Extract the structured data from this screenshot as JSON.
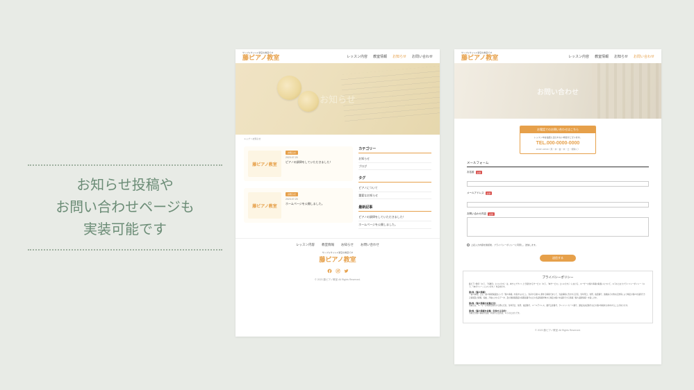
{
  "promo": {
    "line1": "お知らせ投稿や",
    "line2": "お問い合わせページも",
    "line3": "実装可能です"
  },
  "site": {
    "tagline": "サンプルサイト2 架空の教室です",
    "logo": "藤ピアノ教室",
    "nav": {
      "lesson": "レッスン内容",
      "classroom": "教室情報",
      "news": "お知らせ",
      "contact": "お問い合わせ"
    }
  },
  "news_page": {
    "hero_title": "お知らせ",
    "breadcrumb": "トップ > お知らせ",
    "posts": [
      {
        "thumb_text": "藤ピアノ教室",
        "category": "お知らせ",
        "date": "2023.07.25",
        "title": "ピアノの調律をしていただきました！"
      },
      {
        "thumb_text": "藤ピアノ教室",
        "category": "お知らせ",
        "date": "2023.07.25",
        "title": "ホームページを公開しました。"
      }
    ],
    "sidebar": {
      "category_title": "カテゴリー",
      "categories": [
        "お知らせ",
        "ブログ"
      ],
      "tag_title": "タグ",
      "tags": [
        "ピアノについて",
        "重要なお知らせ"
      ],
      "recent_title": "最新記事",
      "recent": [
        "ピアノの調律をしていただきました！",
        "ホームページを公開しました。"
      ]
    }
  },
  "contact_page": {
    "hero_title": "お問い合わせ",
    "call_box": {
      "header": "お電話でのお問い合わせはこちら",
      "note": "レッスン中は電話に出られない場合がございます。",
      "tel_prefix": "TEL.",
      "tel_number": "000-0000-0000",
      "hours": "10:00〜18:00（月・水・金・木・土・祝除く）"
    },
    "form": {
      "title": "メールフォーム",
      "name_label": "お名前",
      "email_label": "メールアドレス",
      "content_label": "お問い合わせ内容",
      "required": "必須",
      "consent": "上記入力内容を確認後、プライバシーポリシーに同意し、送信します。",
      "submit": "送信する"
    },
    "policy": {
      "title": "プライバシーポリシー",
      "intro": "藤ピアノ教室（以下、「当教室」といいます。）は、本ウェブサイト上で提供するサービス（以下、「本サービス」といいます。）における、ユーザーの個人情報の取扱いについて、以下のとおりプライバシーポリシー（以下、「本ポリシー」といいます。）を定めます。",
      "h1": "第1条（個人情報）",
      "p1": "「個人情報」とは、個人情報保護法にいう「個人情報」を指すものとし、生存する個人に関する情報であって、当該情報に含まれる氏名、生年月日、住所、電話番号、連絡先その他の記述等により特定の個人を識別できる情報及び容貌、指紋、声紋にかかるデータ、及び健康保険証の保険者番号などの当該情報単体から特定の個人を識別できる情報（個人識別情報）を指します。",
      "h2": "第2条（個人情報の収集方法）",
      "p2": "当教室は、ユーザーが利用登録をする際に氏名、生年月日、住所、電話番号、メールアドレス、銀行口座番号、クレジットカード番号、運転免許証番号などの個人情報をお尋ねすることがあります。",
      "h3": "第3条（個人情報を収集・利用する目的）",
      "p3": "当教室が個人情報を収集・利用する目的は、以下のとおりです。"
    },
    "copyright": "© 2023 藤ピアノ教室 All Rights Reserved."
  },
  "footer": {
    "copyright": "© 2023 藤ピアノ教室 All Rights Reserved."
  }
}
